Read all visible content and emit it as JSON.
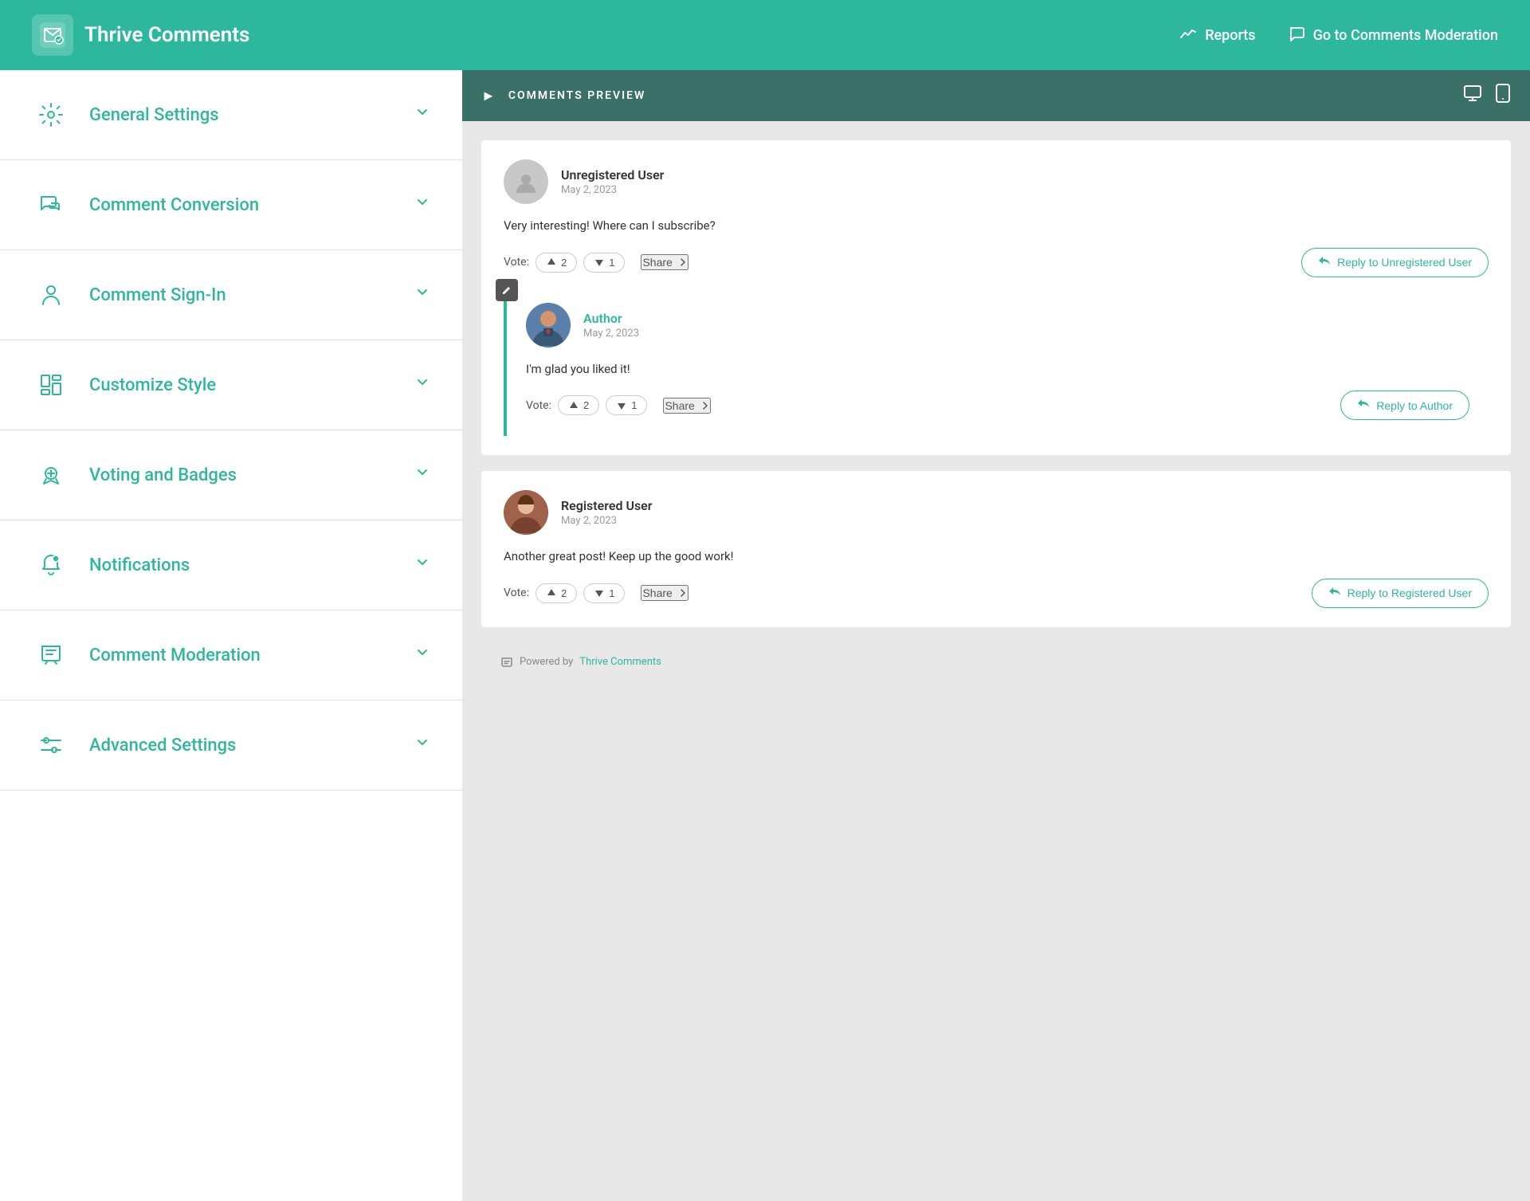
{
  "header": {
    "logo_label": "Thrive Comments",
    "nav": [
      {
        "id": "reports",
        "label": "Reports",
        "icon": "📈"
      },
      {
        "id": "moderation",
        "label": "Go to Comments Moderation",
        "icon": "💬"
      }
    ]
  },
  "sidebar": {
    "items": [
      {
        "id": "general-settings",
        "label": "General Settings",
        "icon": "⚙️"
      },
      {
        "id": "comment-conversion",
        "label": "Comment Conversion",
        "icon": "💬"
      },
      {
        "id": "comment-sign-in",
        "label": "Comment Sign-In",
        "icon": "👤"
      },
      {
        "id": "customize-style",
        "label": "Customize Style",
        "icon": "📐"
      },
      {
        "id": "voting-badges",
        "label": "Voting and Badges",
        "icon": "🏅"
      },
      {
        "id": "notifications",
        "label": "Notifications",
        "icon": "🔔"
      },
      {
        "id": "comment-moderation",
        "label": "Comment Moderation",
        "icon": "💬"
      },
      {
        "id": "advanced-settings",
        "label": "Advanced Settings",
        "icon": "⚙️"
      }
    ]
  },
  "preview": {
    "header_title": "COMMENTS PREVIEW",
    "comments": [
      {
        "id": "unregistered",
        "username": "Unregistered User",
        "date": "May 2, 2023",
        "text": "Very interesting! Where can I subscribe?",
        "vote_up": 2,
        "vote_down": 1,
        "reply_label": "Reply to Unregistered User",
        "is_author": false,
        "is_registered": false,
        "nested": {
          "username": "Author",
          "date": "May 2, 2023",
          "text": "I'm glad you liked it!",
          "vote_up": 2,
          "vote_down": 1,
          "reply_label": "Reply to Author",
          "is_author": true
        }
      },
      {
        "id": "registered",
        "username": "Registered User",
        "date": "May 2, 2023",
        "text": "Another great post! Keep up the good work!",
        "vote_up": 2,
        "vote_down": 1,
        "reply_label": "Reply to Registered User",
        "is_author": false,
        "is_registered": true,
        "nested": null
      }
    ],
    "powered_by_text": "Powered by",
    "powered_by_link": "Thrive Comments"
  }
}
